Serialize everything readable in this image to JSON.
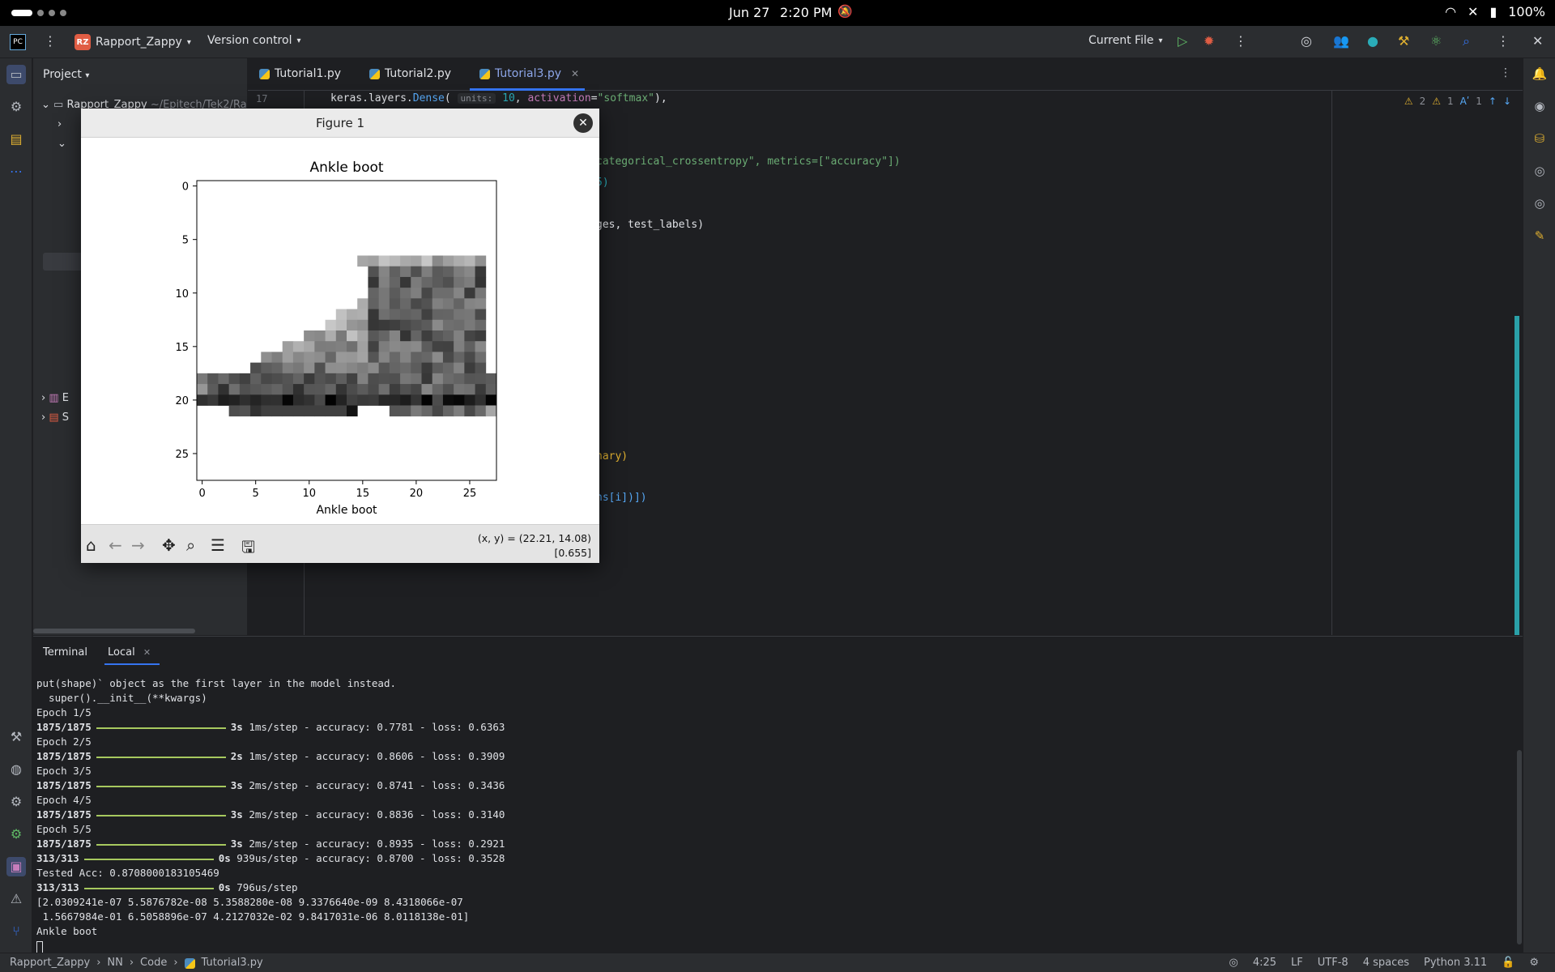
{
  "system": {
    "date": "Jun 27",
    "time": "2:20 PM",
    "battery": "100%"
  },
  "toolbar": {
    "project_badge": "RZ",
    "project_name": "Rapport_Zappy",
    "vcs": "Version control",
    "run_config": "Current File"
  },
  "project_panel": {
    "title": "Project",
    "root_label": "Rapport_Zappy",
    "root_path": "~/Epitech/Tek2/Ra",
    "rows": [
      "E",
      "S"
    ]
  },
  "editor": {
    "tabs": [
      {
        "label": "Tutorial1.py"
      },
      {
        "label": "Tutorial2.py"
      },
      {
        "label": "Tutorial3.py"
      }
    ],
    "line_number": "17",
    "line17": {
      "pre": "keras.layers.",
      "fn": "Dense",
      "open": "( ",
      "hint": "units:",
      "num": " 10",
      "comma": ", ",
      "param": "activation",
      "eq": "=",
      "str": "\"softmax\"",
      "close": "),"
    },
    "partial_lines": [
      {
        "text": "categorical_crossentropy\", metrics=[\"accuracy\"])"
      },
      {
        "text": "5)"
      },
      {
        "text": "ges, test_labels)"
      },
      {
        "text": "nary)"
      },
      {
        "text": "ns[i])])"
      }
    ],
    "inspections": {
      "warnings": "2",
      "weak": "1",
      "typos": "1"
    }
  },
  "figure": {
    "window_title": "Figure 1",
    "close_glyph": "✕",
    "coords_line1": "(x, y) = (22.21, 14.08)",
    "coords_line2": "[0.655]",
    "chart_data": {
      "type": "heatmap",
      "title": "Ankle boot",
      "xlabel": "Ankle boot",
      "ylabel": "",
      "xticks": [
        0,
        5,
        10,
        15,
        20,
        25
      ],
      "yticks": [
        0,
        5,
        10,
        15,
        20,
        25
      ],
      "xlim": [
        -0.5,
        27.5
      ],
      "ylim": [
        27.5,
        -0.5
      ],
      "cmap": "binary",
      "grid": false,
      "rows": 28,
      "cols": 28
    }
  },
  "terminal": {
    "title": "Terminal",
    "tab": "Local",
    "lines": [
      {
        "t": "put(shape)` object as the first layer in the model instead."
      },
      {
        "t": "  super().__init__(**kwargs)"
      },
      {
        "t": "Epoch 1/5"
      },
      {
        "step": "1875/1875",
        "time": "3s",
        "rest": "1ms/step - accuracy: 0.7781 - loss: 0.6363"
      },
      {
        "t": "Epoch 2/5"
      },
      {
        "step": "1875/1875",
        "time": "2s",
        "rest": "1ms/step - accuracy: 0.8606 - loss: 0.3909"
      },
      {
        "t": "Epoch 3/5"
      },
      {
        "step": "1875/1875",
        "time": "3s",
        "rest": "2ms/step - accuracy: 0.8741 - loss: 0.3436"
      },
      {
        "t": "Epoch 4/5"
      },
      {
        "step": "1875/1875",
        "time": "3s",
        "rest": "2ms/step - accuracy: 0.8836 - loss: 0.3140"
      },
      {
        "t": "Epoch 5/5"
      },
      {
        "step": "1875/1875",
        "time": "3s",
        "rest": "2ms/step - accuracy: 0.8935 - loss: 0.2921"
      },
      {
        "step": "313/313",
        "time": "0s",
        "rest": "939us/step - accuracy: 0.8700 - loss: 0.3528"
      },
      {
        "t": "Tested Acc: 0.8708000183105469"
      },
      {
        "step": "313/313",
        "time": "0s",
        "rest": "796us/step"
      },
      {
        "t": "[2.0309241e-07 5.5876782e-08 5.3588280e-08 9.3376640e-09 8.4318066e-07"
      },
      {
        "t": " 1.5667984e-01 6.5058896e-07 4.2127032e-02 9.8417031e-06 8.0118138e-01]"
      },
      {
        "t": "Ankle boot"
      }
    ]
  },
  "statusbar": {
    "crumbs": [
      "Rapport_Zappy",
      "NN",
      "Code",
      "Tutorial3.py"
    ],
    "position": "4:25",
    "line_sep": "LF",
    "encoding": "UTF-8",
    "indent": "4 spaces",
    "interpreter": "Python 3.11"
  },
  "colors": {
    "accent": "#3574f0",
    "progress": "#a7c95f",
    "error_badge": "#e05d44"
  }
}
